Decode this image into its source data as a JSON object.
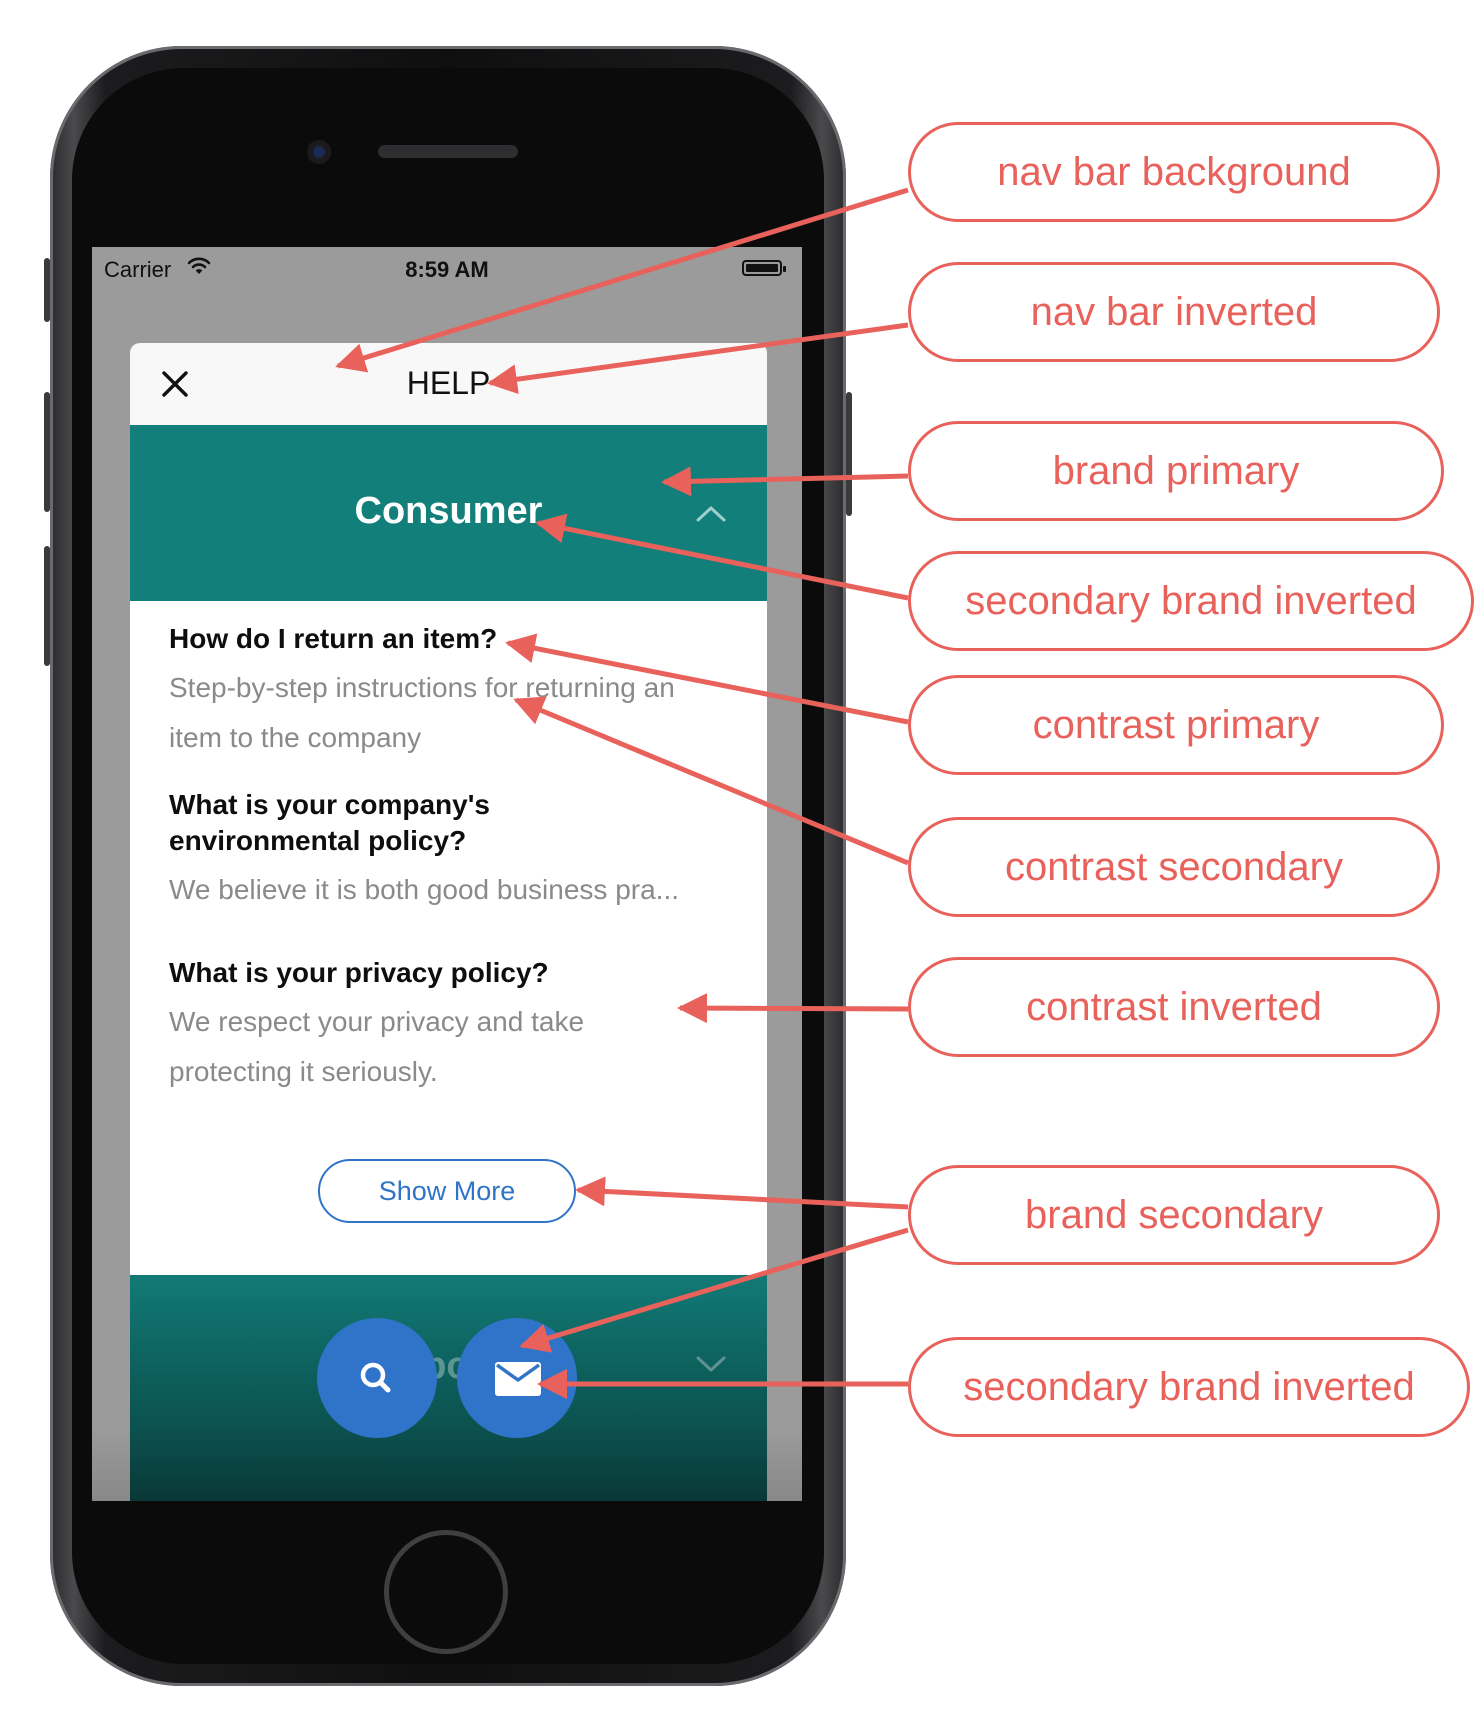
{
  "status_bar": {
    "carrier": "Carrier",
    "time": "8:59 AM"
  },
  "nav": {
    "title": "HELP"
  },
  "sections": [
    {
      "title": "Consumer",
      "expanded": true,
      "faqs": [
        {
          "question": "How do I return an item?",
          "answer": "Step-by-step instructions for returning an item to the company"
        },
        {
          "question": "What is your company's environmental policy?",
          "answer": "We believe it is both good business pra..."
        },
        {
          "question": "What is your privacy policy?",
          "answer": "We respect your privacy and take protecting it seriously."
        }
      ],
      "show_more": "Show More"
    },
    {
      "title": "Corporate",
      "expanded": false
    }
  ],
  "fabs": [
    {
      "icon": "search-icon"
    },
    {
      "icon": "mail-icon"
    }
  ],
  "callouts": [
    "nav bar background",
    "nav bar inverted",
    "brand primary",
    "secondary brand inverted",
    "contrast primary",
    "contrast secondary",
    "contrast inverted",
    "brand secondary",
    "secondary brand inverted"
  ],
  "colors": {
    "nav_bar_background": "#f8f8f8",
    "nav_bar_inverted": "#111111",
    "brand_primary": "#137f7b",
    "secondary_brand_inverted": "#ffffff",
    "contrast_primary": "#0e0e0e",
    "contrast_secondary": "#8a8a8a",
    "contrast_inverted": "#ffffff",
    "brand_secondary": "#2f74c8",
    "annotation": "#e8625b"
  }
}
